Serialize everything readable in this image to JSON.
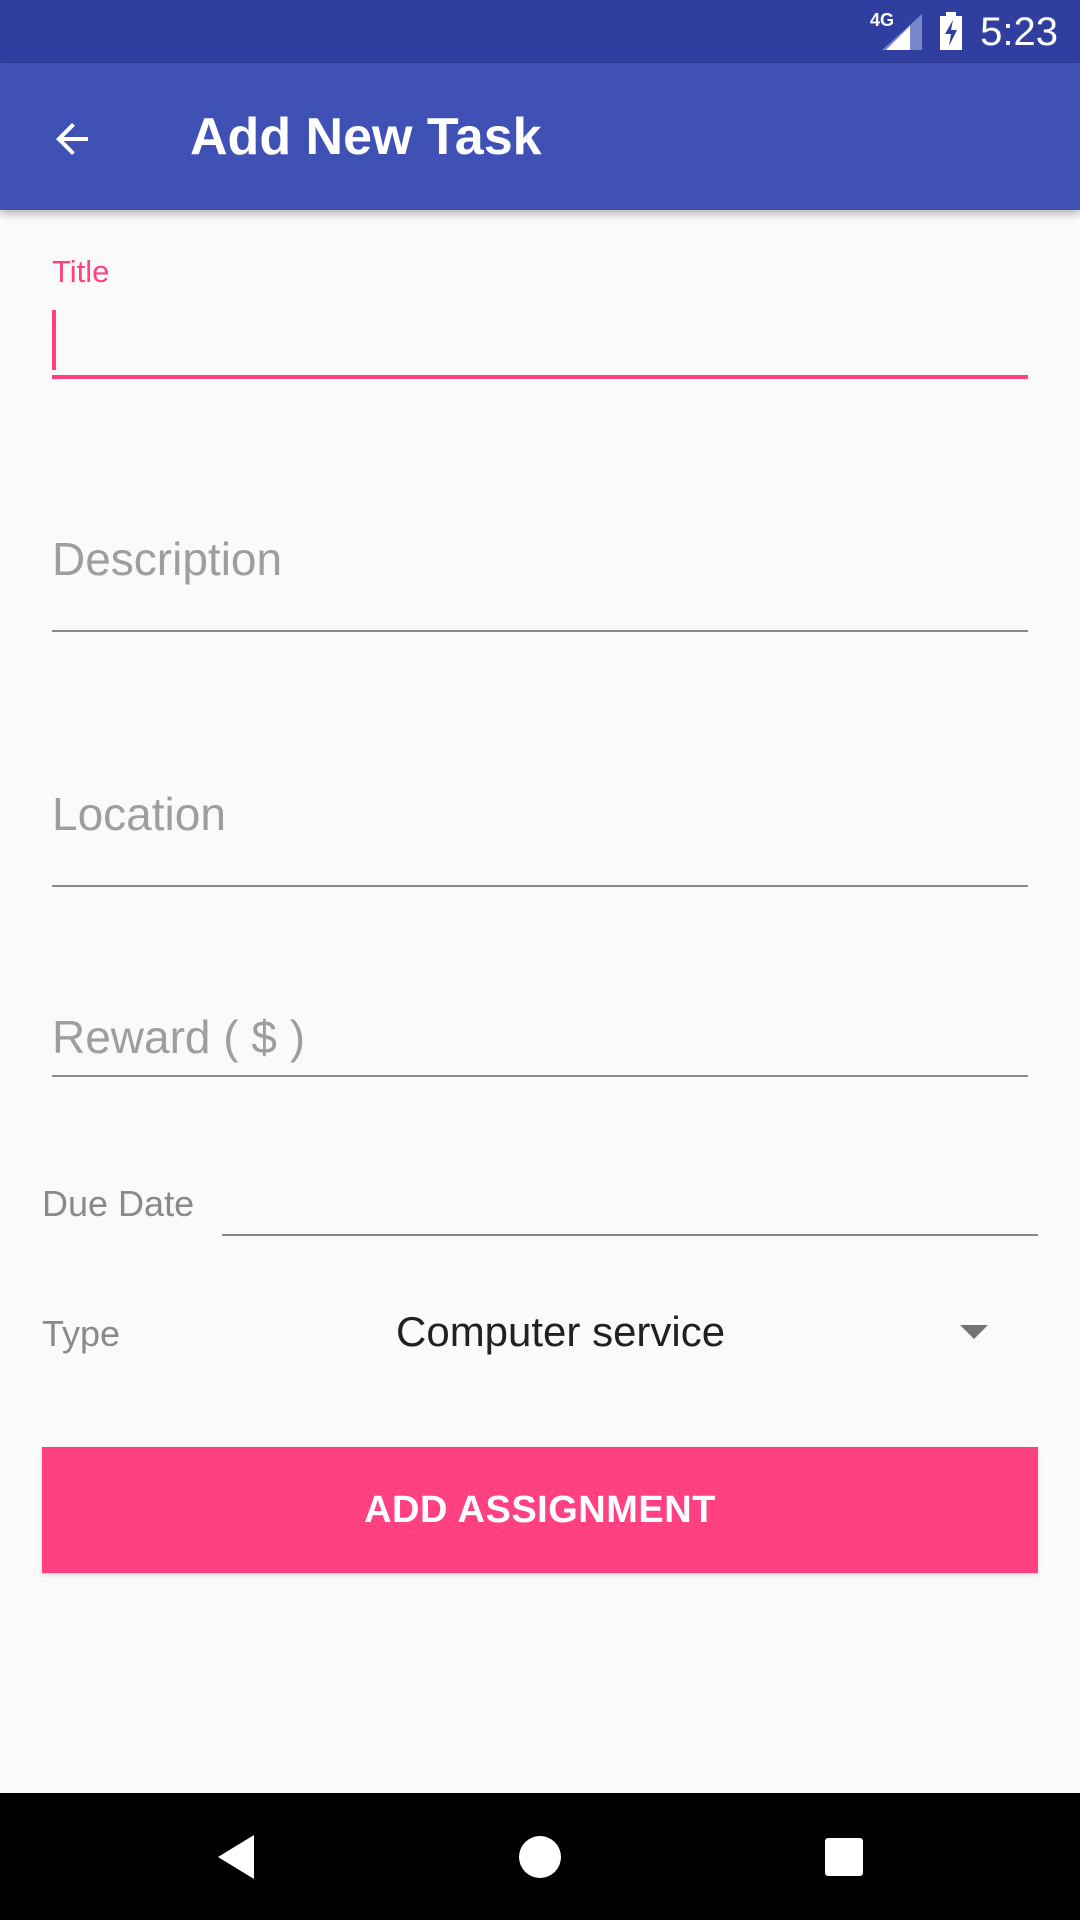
{
  "status_bar": {
    "network": "4G",
    "time": "5:23"
  },
  "app_bar": {
    "title": "Add New Task",
    "back_icon": "arrow-back-icon"
  },
  "form": {
    "title": {
      "label": "Title",
      "value": ""
    },
    "description": {
      "placeholder": "Description",
      "value": ""
    },
    "location": {
      "placeholder": "Location",
      "value": ""
    },
    "reward": {
      "placeholder": "Reward ( $ )",
      "value": ""
    },
    "due_date": {
      "label": "Due Date",
      "value": ""
    },
    "type": {
      "label": "Type",
      "selected": "Computer service"
    }
  },
  "actions": {
    "add_label": "ADD ASSIGNMENT"
  },
  "colors": {
    "primary": "#3f51b5",
    "primary_dark": "#303f9f",
    "accent": "#ff4081"
  }
}
